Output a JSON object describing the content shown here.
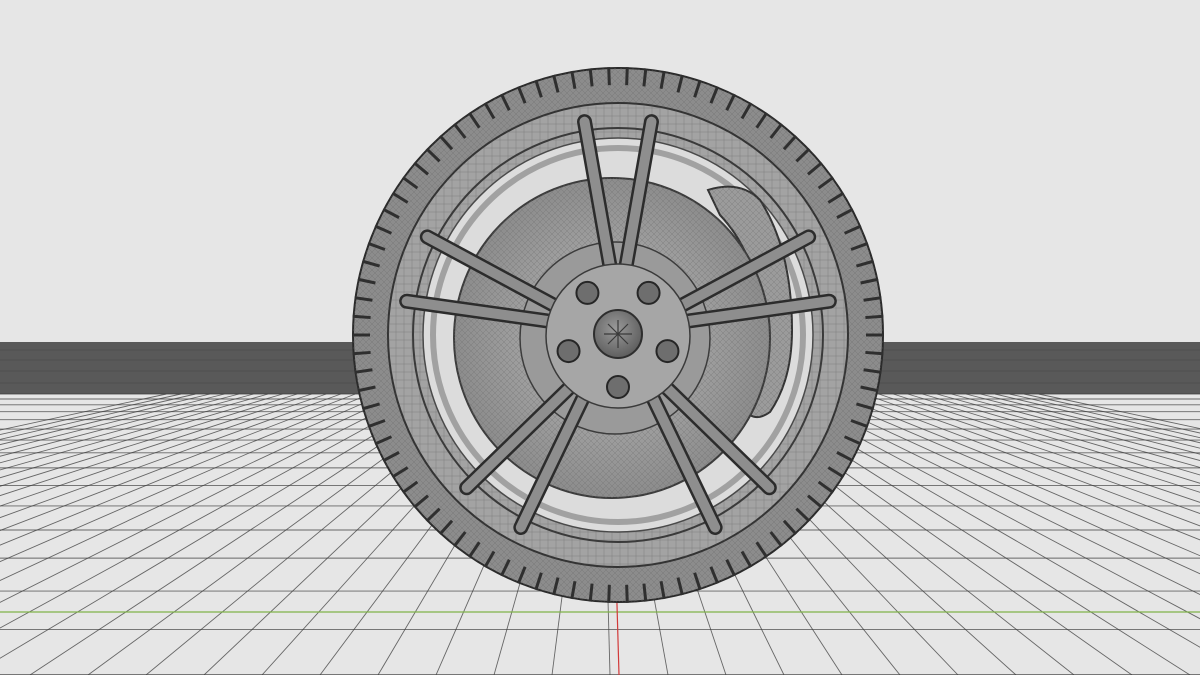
{
  "viewport": {
    "shading_mode": "wireframe-on-shaded",
    "background_color": "#e6e6e6",
    "horizon_band_color": "#595959",
    "grid_line_color": "#3c3c3c",
    "x_axis_color": "#7fb24a",
    "y_axis_color": "#d23a3a"
  },
  "model": {
    "object": "wheel",
    "parts": [
      "tire",
      "rim",
      "spokes",
      "brake-disc",
      "brake-caliper",
      "lug-nuts",
      "center-cap"
    ],
    "spoke_pairs": 5,
    "lug_nuts": 5,
    "mesh_color": "#9a9a9a",
    "wire_color": "#4a4a4a"
  }
}
